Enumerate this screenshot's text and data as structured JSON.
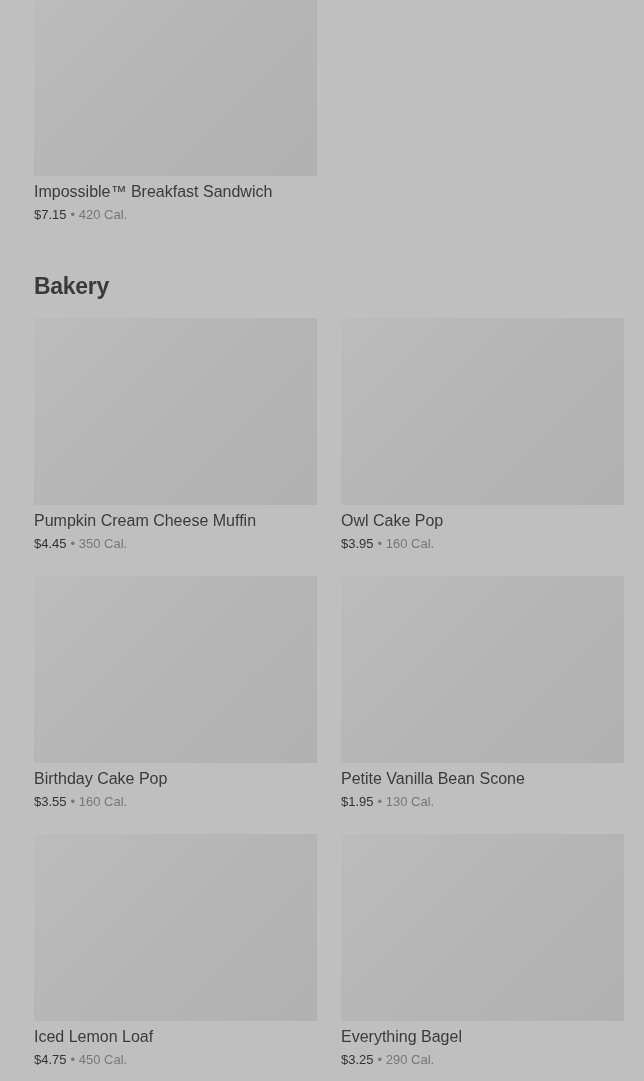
{
  "sections": [
    {
      "items": [
        {
          "name": "Impossible™ Breakfast Sandwich",
          "price": "$7.15",
          "calories": "• 420 Cal."
        }
      ]
    },
    {
      "title": "Bakery",
      "items": [
        {
          "name": "Pumpkin Cream Cheese Muffin",
          "price": "$4.45",
          "calories": "• 350 Cal."
        },
        {
          "name": "Owl Cake Pop",
          "price": "$3.95",
          "calories": "• 160 Cal."
        },
        {
          "name": "Birthday Cake Pop",
          "price": "$3.55",
          "calories": "• 160 Cal."
        },
        {
          "name": "Petite Vanilla Bean Scone",
          "price": "$1.95",
          "calories": "• 130 Cal."
        },
        {
          "name": "Iced Lemon Loaf",
          "price": "$4.75",
          "calories": "• 450 Cal."
        },
        {
          "name": "Everything Bagel",
          "price": "$3.25",
          "calories": "• 290 Cal."
        }
      ]
    }
  ]
}
